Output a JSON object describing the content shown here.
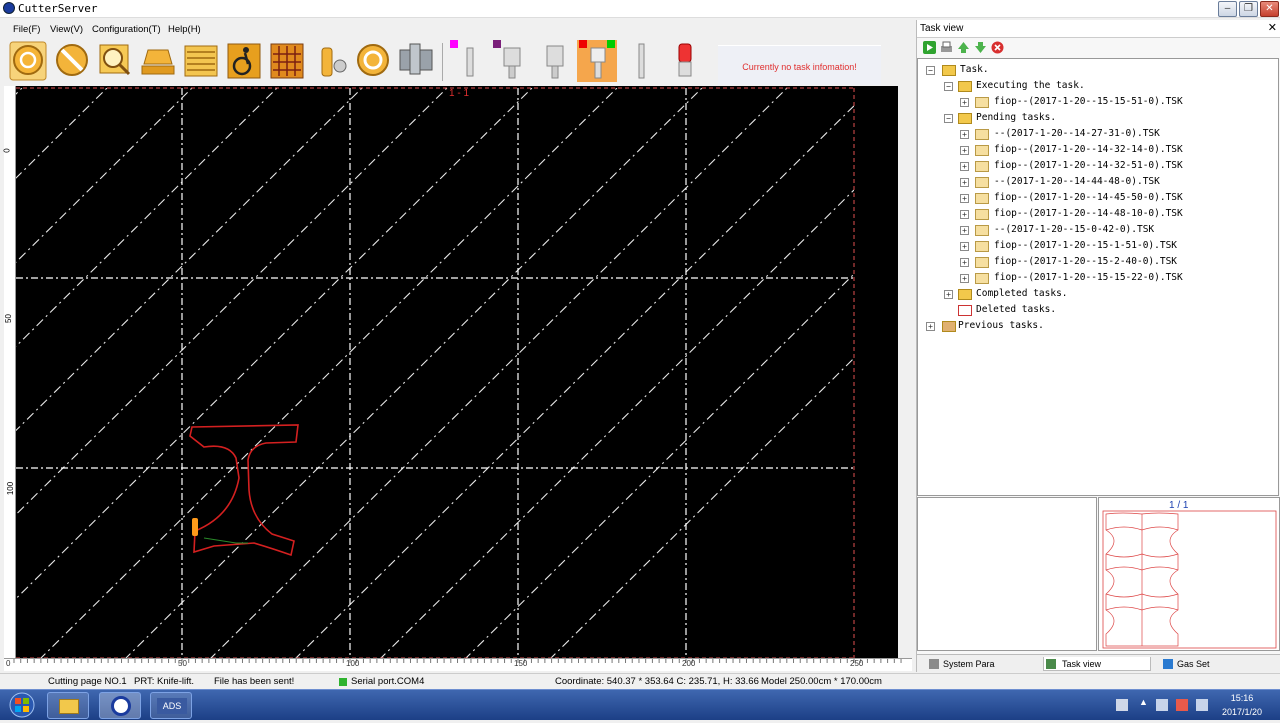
{
  "app": {
    "title": "CutterServer"
  },
  "menu": [
    "File(F)",
    "View(V)",
    "Configuration(T)",
    "Help(H)"
  ],
  "toolbar": {
    "buttons": [
      "start-button",
      "stop-button",
      "search-button",
      "flatten-button",
      "feed-button",
      "disabled-button",
      "grid-button",
      "spray-button",
      "reset-button",
      "machine-button",
      "tool1",
      "tool2",
      "tool3",
      "tool4",
      "tool5",
      "alarm-button"
    ],
    "info": "Currently no task infomation!"
  },
  "canvas": {
    "page_label": "1 - 1",
    "ruler_x": [
      "0",
      "50",
      "100",
      "150",
      "200",
      "250"
    ],
    "ruler_y": [
      "0",
      "50",
      "100"
    ]
  },
  "task_panel": {
    "title": "Task view",
    "tree": {
      "root": "Task.",
      "executing_label": "Executing the task.",
      "executing": [
        "fiop--(2017-1-20--15-15-51-0).TSK"
      ],
      "pending_label": "Pending tasks.",
      "pending": [
        "--(2017-1-20--14-27-31-0).TSK",
        "fiop--(2017-1-20--14-32-14-0).TSK",
        "fiop--(2017-1-20--14-32-51-0).TSK",
        "--(2017-1-20--14-44-48-0).TSK",
        "fiop--(2017-1-20--14-45-50-0).TSK",
        "fiop--(2017-1-20--14-48-10-0).TSK",
        "--(2017-1-20--15-0-42-0).TSK",
        "fiop--(2017-1-20--15-1-51-0).TSK",
        "fiop--(2017-1-20--15-2-40-0).TSK",
        "fiop--(2017-1-20--15-15-22-0).TSK"
      ],
      "completed": "Completed tasks.",
      "deleted": "Deleted tasks.",
      "previous": "Previous tasks."
    },
    "preview_page": "1 / 1",
    "tabs": [
      "System Para",
      "Task view",
      "Gas Set"
    ]
  },
  "status": {
    "page": "Cutting page NO.1",
    "prt": "PRT:  Knife-lift.",
    "file": "File has been sent!",
    "serial": "Serial port.COM4",
    "coordinate": "Coordinate: 540.37 * 353.64 C: 235.71, H: 33.66",
    "model": "Model 250.00cm * 170.00cm"
  },
  "taskbar": {
    "time": "15:16",
    "date": "2017/1/20",
    "apps": [
      "explorer",
      "cutterserver",
      "ads"
    ],
    "ads_label": "ADS"
  },
  "colors": {
    "canvas_bg": "#000000",
    "pattern": "#d42020",
    "accent": "#e03030"
  }
}
